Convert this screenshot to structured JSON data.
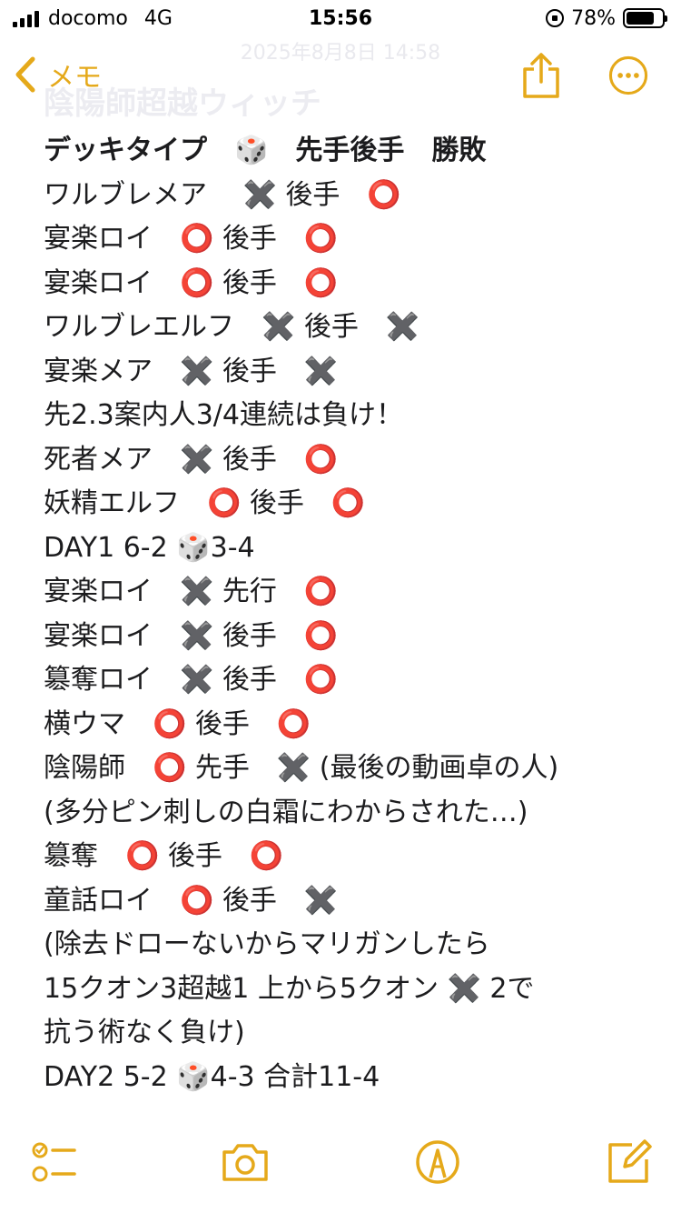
{
  "status_bar": {
    "carrier": "docomo",
    "network": "4G",
    "time": "15:56",
    "battery": "78%",
    "battery_level": 0.78
  },
  "nav": {
    "back_label": "メモ",
    "date_text": "2025年8月8日 14:58"
  },
  "note": {
    "faded_title": "陰陽師超越ウィッチ",
    "lines": [
      "デッキタイプ　🎲　先手後手　勝敗",
      "ワルブレメア　 ✖️ 後手　⭕️",
      "宴楽ロイ　⭕️ 後手　⭕️",
      "宴楽ロイ　⭕️ 後手　⭕️",
      "ワルブレエルフ　✖️ 後手　✖️",
      "宴楽メア　✖️ 後手　✖️",
      "先2.3案内人3/4連続は負け！",
      "死者メア　✖️ 後手　⭕️",
      "妖精エルフ　⭕️ 後手　⭕️",
      "DAY1 6-2 🎲3-4",
      "宴楽ロイ　✖️ 先行　⭕️",
      "宴楽ロイ　✖️ 後手　⭕️",
      "簒奪ロイ　✖️ 後手　⭕️",
      "横ウマ　⭕️ 後手　⭕️",
      "陰陽師　⭕️ 先手　✖️ (最後の動画卓の人)",
      "(多分ピン刺しの白霜にわからされた…)",
      "簒奪　⭕️ 後手　⭕️",
      "童話ロイ　⭕️ 後手　✖️",
      "(除去ドローないからマリガンしたら",
      "15クオン3超越1 上から5クオン ✖️ 2で",
      "抗う術なく負け)",
      "DAY2 5-2 🎲4-3 合計11-4"
    ]
  },
  "colors": {
    "accent": "#e5a91a",
    "text": "#1c1c1e"
  },
  "icons": {
    "back": "chevron-left-icon",
    "share": "share-icon",
    "more": "more-icon",
    "checklist": "checklist-icon",
    "camera": "camera-icon",
    "markup": "markup-pen-icon",
    "compose": "compose-icon"
  }
}
